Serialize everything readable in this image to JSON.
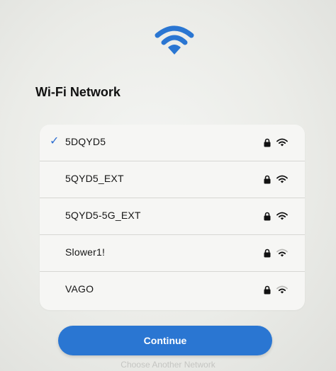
{
  "header": {
    "icon": "wifi-icon",
    "title": "Wi-Fi Network"
  },
  "networks": [
    {
      "name": "5DQYD5",
      "selected": true,
      "secured": true,
      "signal": "strong"
    },
    {
      "name": "5QYD5_EXT",
      "selected": false,
      "secured": true,
      "signal": "strong"
    },
    {
      "name": "5QYD5-5G_EXT",
      "selected": false,
      "secured": true,
      "signal": "strong"
    },
    {
      "name": "Slower1!",
      "selected": false,
      "secured": true,
      "signal": "weak"
    },
    {
      "name": "VAGO",
      "selected": false,
      "secured": true,
      "signal": "weak"
    }
  ],
  "footer": {
    "continue_label": "Continue",
    "other_label": "Choose Another Network"
  },
  "colors": {
    "accent": "#2a76d2",
    "checkmark": "#2f6fd1"
  }
}
